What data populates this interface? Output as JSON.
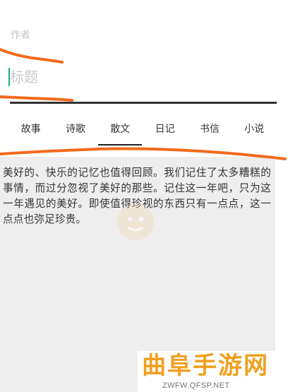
{
  "editor": {
    "author_placeholder": "作者",
    "title_placeholder": "标题"
  },
  "tabs": [
    {
      "label": "故事"
    },
    {
      "label": "诗歌"
    },
    {
      "label": "散文"
    },
    {
      "label": "日记"
    },
    {
      "label": "书信"
    },
    {
      "label": "小说"
    }
  ],
  "active_tab": "散文",
  "content": {
    "body": "美好的、快乐的记忆也值得回顾。我们记住了太多糟糕的事情，而过分忽视了美好的那些。记住这一年吧，只为这一年遇见的美好。即使值得珍视的东西只有一点点，这一点点也弥足珍贵。"
  },
  "watermark": {
    "brand": "曲阜手游网",
    "url": "ZWFW.QFSP.NET"
  },
  "colors": {
    "annotation": "#f26a1b",
    "caret": "#1ba98d",
    "content_bg": "#eeeeee",
    "watermark": "#f0a020"
  },
  "icons": {
    "mascot": "mascot-logo-icon"
  }
}
